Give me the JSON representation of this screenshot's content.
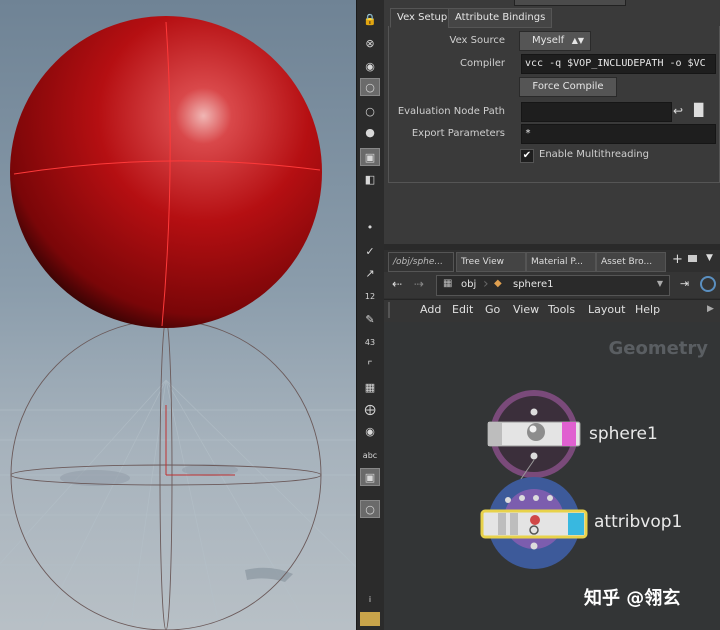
{
  "toolbar_top": {
    "blank_field": ""
  },
  "param_pane": {
    "tabs": [
      {
        "label": "Vex Setup"
      },
      {
        "label": "Attribute Bindings"
      }
    ],
    "vex_source_label": "Vex Source",
    "vex_source_value": "Myself",
    "compiler_label": "Compiler",
    "compiler_value": "vcc -q $VOP_INCLUDEPATH -o $VC",
    "force_compile_label": "Force Compile",
    "eval_node_path_label": "Evaluation Node Path",
    "eval_node_path_value": "",
    "export_params_label": "Export Parameters",
    "export_params_value": "*",
    "multithread_label": "Enable Multithreading",
    "multithread_checked": true
  },
  "network_pane": {
    "tabs": [
      {
        "label": "/obj/sphe..."
      },
      {
        "label": "Tree View"
      },
      {
        "label": "Material P..."
      },
      {
        "label": "Asset Bro..."
      }
    ],
    "path": [
      "obj",
      "sphere1"
    ],
    "menu": [
      "Add",
      "Edit",
      "Go",
      "View",
      "Tools",
      "Layout",
      "Help"
    ],
    "context_label": "Geometry",
    "nodes": [
      {
        "name": "sphere1"
      },
      {
        "name": "attribvop1"
      }
    ]
  },
  "toolbar_icons": [
    "lock-icon",
    "stop-icon",
    "light-icon",
    "bulb-icon",
    "bulb-icon",
    "bulb-icon",
    "camera-icon",
    "wireframe-icon",
    "dot-icon",
    "check-icon",
    "pin-icon",
    "number-icon",
    "brush-icon",
    "number-icon",
    "corner-icon",
    "grid-icon",
    "arrows-icon",
    "circle-icon",
    "text-icon",
    "image-icon",
    "bulb-icon",
    "info-icon"
  ],
  "toolbar_text": {
    "n12": "12",
    "n43": "43",
    "abc": "abc",
    "info": "i"
  },
  "watermark": "知乎 @翎玄",
  "colors": {
    "sphere_red": "#b30f10",
    "panel_bg": "#3a3a3a",
    "network_bg": "#333536",
    "node_ring_purple": "#7a4a7a",
    "node_ring_blue": "#4a6aa8",
    "node_select_yellow": "#e8d24a",
    "accent_cyan": "#38b8e0",
    "accent_pink": "#e060d0"
  }
}
